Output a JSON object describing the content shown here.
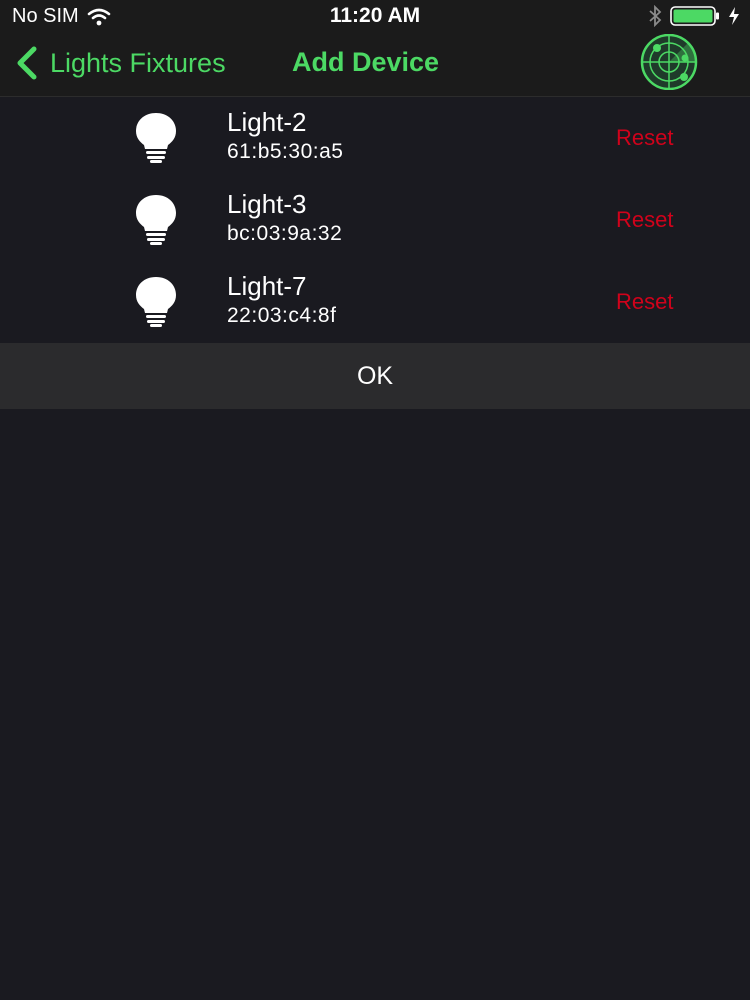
{
  "status_bar": {
    "carrier": "No SIM",
    "time": "11:20 AM",
    "icons": [
      "wifi-icon",
      "bluetooth-icon",
      "battery-icon",
      "charging-icon"
    ]
  },
  "nav": {
    "back_label": "Lights Fixtures",
    "title": "Add Device",
    "scan_icon": "radar-icon"
  },
  "devices": [
    {
      "name": "Light-2",
      "mac": "61:b5:30:a5",
      "action": "Reset"
    },
    {
      "name": "Light-3",
      "mac": "bc:03:9a:32",
      "action": "Reset"
    },
    {
      "name": "Light-7",
      "mac": "22:03:c4:8f",
      "action": "Reset"
    }
  ],
  "ok_label": "OK",
  "colors": {
    "accent": "#4cd964",
    "reset": "#d0021b",
    "background": "#1a1a20",
    "bar": "#1b1b1b",
    "ok_bar": "#2b2b2d"
  }
}
